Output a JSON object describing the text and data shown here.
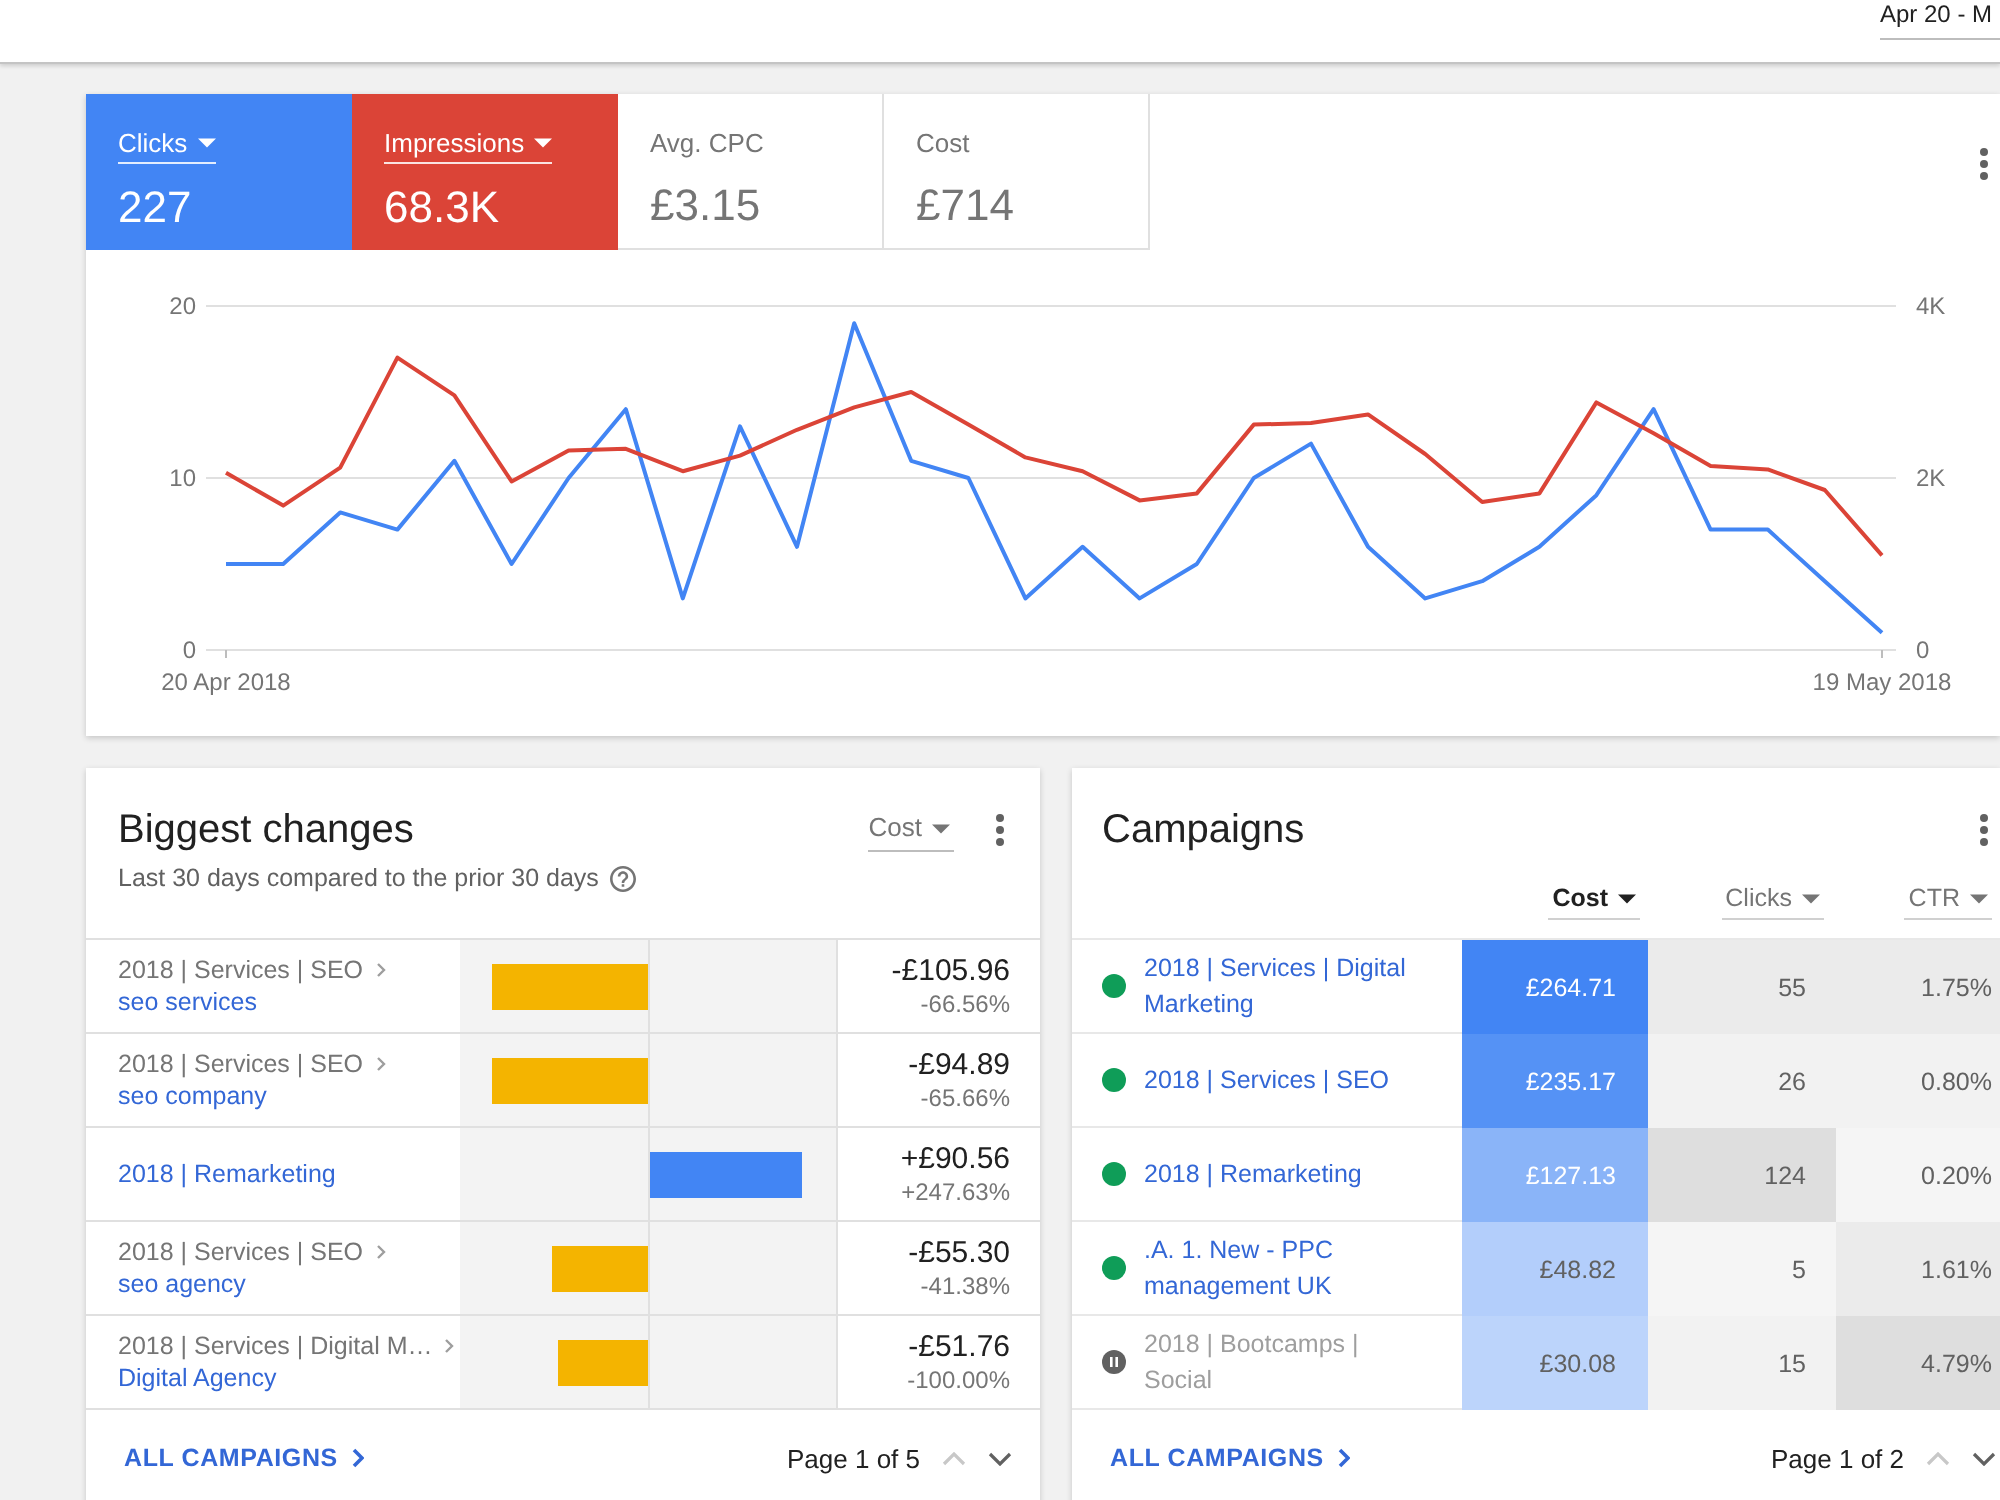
{
  "top_bar": {
    "date_range": {
      "value": "Apr 20 - M"
    }
  },
  "performance": {
    "metrics": [
      {
        "label": "Clicks",
        "value": "227",
        "selected": true,
        "color": "#4285f4"
      },
      {
        "label": "Impressions",
        "value": "68.3K",
        "selected": true,
        "color": "#db4437"
      },
      {
        "label": "Avg. CPC",
        "value": "£3.15",
        "selected": false
      },
      {
        "label": "Cost",
        "value": "£714",
        "selected": false
      }
    ],
    "chart_data": {
      "type": "line",
      "categories": [
        "20 Apr 2018",
        null,
        null,
        null,
        null,
        null,
        null,
        null,
        null,
        null,
        null,
        null,
        null,
        null,
        null,
        null,
        null,
        null,
        null,
        null,
        null,
        null,
        null,
        null,
        null,
        null,
        null,
        null,
        null,
        "19 May 2018"
      ],
      "ylim": [
        0,
        20
      ],
      "yticks": [
        0,
        10,
        20
      ],
      "y2lim": [
        0,
        4000
      ],
      "y2ticks": [
        {
          "value": 0,
          "label": "0"
        },
        {
          "value": 2000,
          "label": "2K"
        },
        {
          "value": 4000,
          "label": "4K"
        }
      ],
      "series": [
        {
          "color": "#4285f4",
          "values": [
            5,
            5,
            8,
            7,
            11,
            5,
            10,
            14,
            3,
            13,
            6,
            19,
            11,
            10,
            3,
            6,
            3,
            5,
            10,
            12,
            6,
            3,
            4,
            6,
            9,
            14,
            7,
            7,
            4,
            1
          ]
        },
        {
          "color": "#db4437",
          "axis": "y2",
          "values": [
            2060,
            1680,
            2120,
            3400,
            2960,
            1960,
            2320,
            2340,
            2080,
            2260,
            2560,
            2820,
            3000,
            2620,
            2240,
            2080,
            1740,
            1820,
            2620,
            2640,
            2740,
            2280,
            1720,
            1820,
            2880,
            2520,
            2140,
            2100,
            1860,
            1100
          ]
        }
      ]
    }
  },
  "biggest_changes": {
    "title": "Biggest changes",
    "subtitle": "Last 30 days compared to the prior 30 days",
    "metric": "Cost",
    "rows": [
      {
        "parent": "2018 | Services | SEO",
        "name": "seo services",
        "increase": false,
        "level": 0.83,
        "change": "-£105.96",
        "percent": "-66.56%"
      },
      {
        "parent": "2018 | Services | SEO",
        "name": "seo company",
        "increase": false,
        "level": 0.83,
        "change": "-£94.89",
        "percent": "-65.66%"
      },
      {
        "name": "2018 | Remarketing",
        "increase": true,
        "level": 0.82,
        "change": "+£90.56",
        "percent": "+247.63%"
      },
      {
        "parent": "2018 | Services | SEO",
        "name": "seo agency",
        "increase": false,
        "level": 0.51,
        "change": "-£55.30",
        "percent": "-41.38%"
      },
      {
        "parent": "2018 | Services | Digital M…",
        "name": "Digital Agency",
        "increase": false,
        "level": 0.48,
        "change": "-£51.76",
        "percent": "-100.00%"
      }
    ],
    "footer": {
      "link": "ALL CAMPAIGNS",
      "pager": {
        "label": "Page 1 of 5",
        "previous_disabled": true,
        "next_disabled": false
      }
    }
  },
  "campaigns": {
    "title": "Campaigns",
    "columns": [
      {
        "label": "Cost",
        "selected": true
      },
      {
        "label": "Clicks",
        "selected": false
      },
      {
        "label": "CTR",
        "selected": false
      }
    ],
    "rows": [
      {
        "name": "2018 | Services | Digital Marketing",
        "paused": false,
        "cells": [
          {
            "text": "£264.71",
            "color": "#4285f4"
          },
          {
            "text": "55",
            "color": "#ebebeb"
          },
          {
            "text": "1.75%",
            "color": "#ebebeb"
          }
        ]
      },
      {
        "name": "2018 | Services | SEO",
        "paused": false,
        "cells": [
          {
            "text": "£235.17",
            "color": "#5592f5"
          },
          {
            "text": "26",
            "color": "#f2f2f2"
          },
          {
            "text": "0.80%",
            "color": "#f2f2f2"
          }
        ]
      },
      {
        "name": "2018 | Remarketing",
        "paused": false,
        "cells": [
          {
            "text": "£127.13",
            "color": "#8ab4f8"
          },
          {
            "text": "124",
            "color": "#dedede"
          },
          {
            "text": "0.20%",
            "color": "#f5f5f5"
          }
        ]
      },
      {
        "name": ".A. 1. New - PPC management UK",
        "paused": false,
        "cells": [
          {
            "text": "£48.82",
            "color": "#b3cefb"
          },
          {
            "text": "5",
            "color": "#f5f5f5"
          },
          {
            "text": "1.61%",
            "color": "#ebebeb"
          }
        ]
      },
      {
        "name": "2018 | Bootcamps | Social",
        "paused": true,
        "cells": [
          {
            "text": "£30.08",
            "color": "#bcd4fb"
          },
          {
            "text": "15",
            "color": "#f2f2f2"
          },
          {
            "text": "4.79%",
            "color": "#dedede"
          }
        ]
      }
    ],
    "footer": {
      "link": "ALL CAMPAIGNS",
      "pager": {
        "label": "Page 1 of 2",
        "previous_disabled": true,
        "next_disabled": false
      }
    }
  }
}
